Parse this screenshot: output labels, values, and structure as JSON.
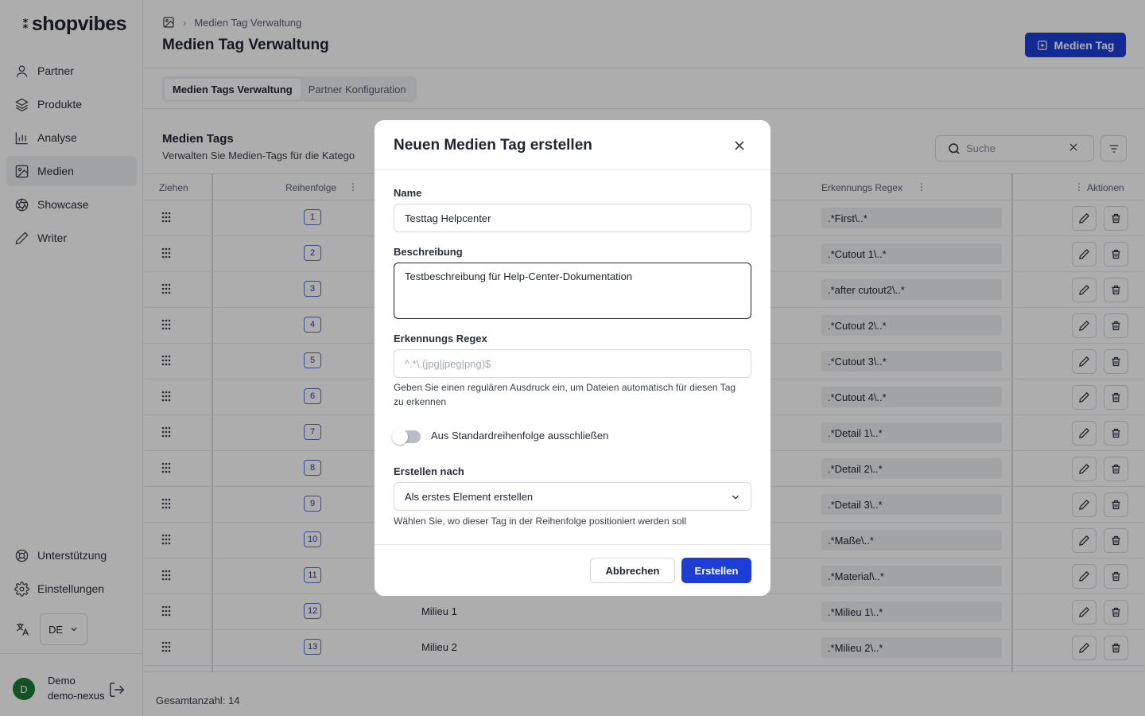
{
  "app": {
    "logo": "shopvibes"
  },
  "sidebar": {
    "items": [
      {
        "label": "Partner",
        "icon": "user-icon"
      },
      {
        "label": "Produkte",
        "icon": "layers-icon"
      },
      {
        "label": "Analyse",
        "icon": "bar-chart-icon"
      },
      {
        "label": "Medien",
        "icon": "image-icon",
        "active": true
      },
      {
        "label": "Showcase",
        "icon": "aperture-icon"
      },
      {
        "label": "Writer",
        "icon": "pen-icon"
      }
    ],
    "bottom": [
      {
        "label": "Unterstützung",
        "icon": "lifebuoy-icon"
      },
      {
        "label": "Einstellungen",
        "icon": "gear-icon"
      }
    ],
    "language": "DE",
    "user": {
      "initial": "D",
      "name": "Demo",
      "sub": "demo-nexus"
    }
  },
  "header": {
    "breadcrumb": "Medien Tag Verwaltung",
    "title": "Medien Tag Verwaltung",
    "primary_button": "Medien Tag"
  },
  "tabs": [
    {
      "label": "Medien Tags Verwaltung",
      "active": true
    },
    {
      "label": "Partner Konfiguration",
      "active": false
    }
  ],
  "section": {
    "title": "Medien Tags",
    "subtitle": "Verwalten Sie Medien-Tags für die Katego",
    "search_placeholder": "Suche"
  },
  "table": {
    "columns": [
      "Ziehen",
      "Reihenfolge",
      "Erkennungs Regex",
      "Aktionen"
    ],
    "rows": [
      {
        "order": "1",
        "name": "",
        "regex": ".*First\\..*"
      },
      {
        "order": "2",
        "name": "",
        "regex": ".*Cutout 1\\..*"
      },
      {
        "order": "3",
        "name": "",
        "regex": ".*after cutout2\\..*"
      },
      {
        "order": "4",
        "name": "",
        "regex": ".*Cutout 2\\..*"
      },
      {
        "order": "5",
        "name": "",
        "regex": ".*Cutout 3\\..*"
      },
      {
        "order": "6",
        "name": "",
        "regex": ".*Cutout 4\\..*"
      },
      {
        "order": "7",
        "name": "",
        "regex": ".*Detail 1\\..*"
      },
      {
        "order": "8",
        "name": "",
        "regex": ".*Detail 2\\..*"
      },
      {
        "order": "9",
        "name": "",
        "regex": ".*Detail 3\\..*"
      },
      {
        "order": "10",
        "name": "",
        "regex": ".*Maße\\..*"
      },
      {
        "order": "11",
        "name": "",
        "regex": ".*Material\\..*"
      },
      {
        "order": "12",
        "name": "Milieu 1",
        "regex": ".*Milieu 1\\..*"
      },
      {
        "order": "13",
        "name": "Milieu 2",
        "regex": ".*Milieu 2\\..*"
      }
    ],
    "total": "Gesamtanzahl: 14"
  },
  "modal": {
    "title": "Neuen Medien Tag erstellen",
    "name_label": "Name",
    "name_value": "Testtag Helpcenter",
    "desc_label": "Beschreibung",
    "desc_value": "Testbeschreibung für Help-Center-Dokumentation",
    "regex_label": "Erkennungs Regex",
    "regex_placeholder": "^.*\\.(jpg|jpeg|png)$",
    "regex_hint": "Geben Sie einen regulären Ausdruck ein, um Dateien automatisch für diesen Tag zu erkennen",
    "toggle_label": "Aus Standardreihenfolge ausschließen",
    "toggle_on": false,
    "after_label": "Erstellen nach",
    "after_value": "Als erstes Element erstellen",
    "after_hint": "Wählen Sie, wo dieser Tag in der Reihenfolge positioniert werden soll",
    "cancel": "Abbrechen",
    "create": "Erstellen"
  },
  "colors": {
    "accent": "#1c3ed7",
    "avatar": "#1b7a34"
  }
}
